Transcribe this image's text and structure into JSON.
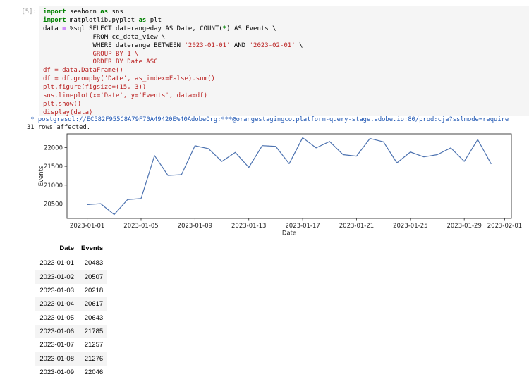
{
  "notebook": {
    "prompt": "[5]:",
    "colors": {
      "keyword_green": "#008000",
      "operator_purple": "#AA22FF",
      "string_red": "#BA2121",
      "cell_background": "#f5f5f5",
      "connection_blue": "#1c54b2"
    },
    "code_lines": [
      [
        {
          "t": "import",
          "c": "kw"
        },
        {
          "t": " seaborn ",
          "c": "pl"
        },
        {
          "t": "as",
          "c": "kw"
        },
        {
          "t": " sns",
          "c": "pl"
        }
      ],
      [
        {
          "t": "import",
          "c": "kw"
        },
        {
          "t": " matplotlib.pyplot ",
          "c": "pl"
        },
        {
          "t": "as",
          "c": "kw"
        },
        {
          "t": " plt",
          "c": "pl"
        }
      ],
      [
        {
          "t": "data ",
          "c": "pl"
        },
        {
          "t": "=",
          "c": "op"
        },
        {
          "t": " %sql SELECT daterangeday AS Date, COUNT(",
          "c": "pl"
        },
        {
          "t": "*",
          "c": "kw"
        },
        {
          "t": ") AS Events \\",
          "c": "pl"
        }
      ],
      [
        {
          "t": "             FROM cc_data_view \\",
          "c": "pl"
        }
      ],
      [
        {
          "t": "             WHERE daterange BETWEEN ",
          "c": "pl"
        },
        {
          "t": "'2023-01-01'",
          "c": "str"
        },
        {
          "t": " AND ",
          "c": "pl"
        },
        {
          "t": "'2023-02-01'",
          "c": "str"
        },
        {
          "t": " \\",
          "c": "pl"
        }
      ],
      [
        {
          "t": "             GROUP BY 1 \\",
          "c": "str"
        }
      ],
      [
        {
          "t": "             ORDER BY Date ASC",
          "c": "str"
        }
      ],
      [
        {
          "t": "df = data.DataFrame()",
          "c": "str"
        }
      ],
      [
        {
          "t": "df = df.groupby('Date', as_index=False).sum()",
          "c": "str"
        }
      ],
      [
        {
          "t": "plt.figure(figsize=(15, 3))",
          "c": "str"
        }
      ],
      [
        {
          "t": "sns.lineplot(x='Date', y='Events', data=df)",
          "c": "str"
        }
      ],
      [
        {
          "t": "plt.show()",
          "c": "str"
        }
      ],
      [
        {
          "t": "display(data)",
          "c": "str"
        }
      ]
    ]
  },
  "output": {
    "connection_line": " * postgresql://EC582F955C8A79F70A49420E%40AdobeOrg:***@orangestagingco.platform-query-stage.adobe.io:80/prod:cja?sslmode=require",
    "rows_affected": "31 rows affected."
  },
  "chart_data": {
    "type": "line",
    "title": "",
    "xlabel": "Date",
    "ylabel": "Events",
    "x": [
      "2023-01-01",
      "2023-01-02",
      "2023-01-03",
      "2023-01-04",
      "2023-01-05",
      "2023-01-06",
      "2023-01-07",
      "2023-01-08",
      "2023-01-09",
      "2023-01-10",
      "2023-01-11",
      "2023-01-12",
      "2023-01-13",
      "2023-01-14",
      "2023-01-15",
      "2023-01-16",
      "2023-01-17",
      "2023-01-18",
      "2023-01-19",
      "2023-01-20",
      "2023-01-21",
      "2023-01-22",
      "2023-01-23",
      "2023-01-24",
      "2023-01-25",
      "2023-01-26",
      "2023-01-27",
      "2023-01-28",
      "2023-01-29",
      "2023-01-30",
      "2023-01-31"
    ],
    "values": [
      20483,
      20507,
      20218,
      20617,
      20643,
      21785,
      21257,
      21276,
      22046,
      21970,
      21630,
      21870,
      21470,
      22050,
      22030,
      21570,
      22260,
      21990,
      22160,
      21810,
      21770,
      22240,
      22150,
      21590,
      21880,
      21750,
      21810,
      21990,
      21630,
      22210,
      21560
    ],
    "ylim": [
      20116,
      22362
    ],
    "yticks": [
      20500,
      21000,
      21500,
      22000
    ],
    "xticks": [
      "2023-01-01",
      "2023-01-05",
      "2023-01-09",
      "2023-01-13",
      "2023-01-17",
      "2023-01-21",
      "2023-01-25",
      "2023-01-29",
      "2023-02-01"
    ],
    "xtick_days": [
      1,
      5,
      9,
      13,
      17,
      21,
      25,
      29,
      32
    ],
    "xlim_days": [
      -0.5,
      32.5
    ],
    "line_color": "#4c72b0",
    "grid": false,
    "legend": "none"
  },
  "table": {
    "columns": [
      "Date",
      "Events"
    ],
    "rows": [
      [
        "2023-01-01",
        "20483"
      ],
      [
        "2023-01-02",
        "20507"
      ],
      [
        "2023-01-03",
        "20218"
      ],
      [
        "2023-01-04",
        "20617"
      ],
      [
        "2023-01-05",
        "20643"
      ],
      [
        "2023-01-06",
        "21785"
      ],
      [
        "2023-01-07",
        "21257"
      ],
      [
        "2023-01-08",
        "21276"
      ],
      [
        "2023-01-09",
        "22046"
      ]
    ]
  }
}
